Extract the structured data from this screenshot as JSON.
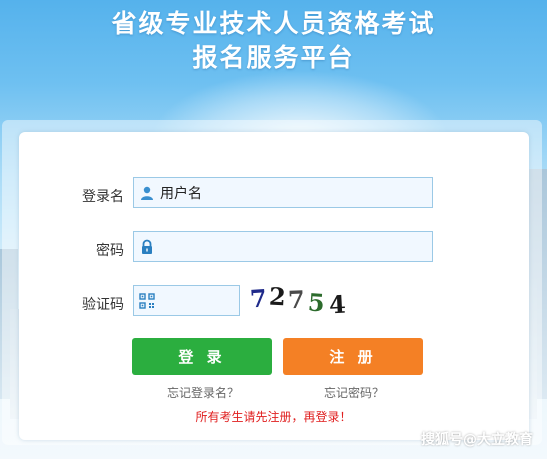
{
  "header": {
    "title_line1": "省级专业技术人员资格考试",
    "title_line2": "报名服务平台"
  },
  "form": {
    "username_label": "登录名",
    "username_value": "用户名",
    "username_icon": "user-icon",
    "password_label": "密码",
    "password_value": "",
    "password_icon": "lock-icon",
    "captcha_label": "验证码",
    "captcha_value": "",
    "captcha_icon": "qr-code-icon",
    "captcha_chars": [
      "7",
      "2",
      "7",
      "5",
      "4"
    ],
    "captcha_colors": [
      "#1f2a8a",
      "#1a1a1a",
      "#4a4a4a",
      "#2c6b2c",
      "#1a1a1a"
    ]
  },
  "buttons": {
    "login": "登 录",
    "register": "注 册",
    "login_color": "#2bae3f",
    "register_color": "#f48025"
  },
  "links": {
    "forgot_username": "忘记登录名？",
    "forgot_password": "忘记密码？"
  },
  "notice": "所有考生请先注册，再登录！",
  "watermark": "搜狐号@大立教育"
}
